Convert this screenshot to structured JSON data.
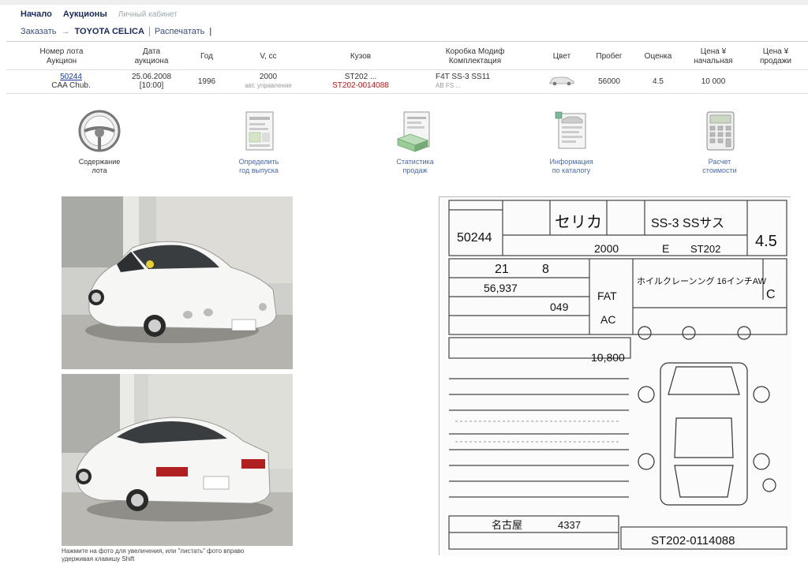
{
  "nav": {
    "home": "Начало",
    "auctions": "Аукционы",
    "cabinet": "Личный кабинет"
  },
  "breadcrumb": {
    "order": "Заказать",
    "arrow": "→",
    "model": "TOYOTA CELICA",
    "separator": "|",
    "print": "Распечатать",
    "end": "|"
  },
  "table": {
    "headers": {
      "lot": [
        "Номер лота",
        "Аукцион"
      ],
      "date": [
        "Дата",
        "аукциона"
      ],
      "year": "Год",
      "cc": "V, cc",
      "body": "Кузов",
      "gear": [
        "Коробка Модиф",
        "Комплектация"
      ],
      "color": "Цвет",
      "run": "Пробег",
      "grade": "Оценка",
      "start": [
        "Цена ¥",
        "начальная"
      ],
      "sell": [
        "Цена ¥",
        "продажи"
      ]
    },
    "row": {
      "lot_no": "50244",
      "auction": "CAA Chub.",
      "date": "25.06.2008",
      "time": "[10:00]",
      "year": "1996",
      "cc": "2000",
      "cc_note": "авт. управление",
      "body": "ST202 ...",
      "body_code": "ST202-0014088",
      "gear": "F4T SS-3 SS11",
      "gear2": "AB FS ...",
      "run": "56000",
      "grade": "4.5",
      "start": "10 000",
      "sell": ""
    }
  },
  "tools": [
    {
      "name": "contents",
      "l1": "Содержание",
      "l2": "лота"
    },
    {
      "name": "define-year",
      "l1": "Определить",
      "l2": "год выпуска"
    },
    {
      "name": "statistics",
      "l1": "Статистика",
      "l2": "продаж"
    },
    {
      "name": "catalog-info",
      "l1": "Информация",
      "l2": "по каталогу"
    },
    {
      "name": "cost-calc",
      "l1": "Расчет",
      "l2": "стоимости"
    }
  ],
  "caption": {
    "l1": "Нажмите на фото для увеличения, или \"листать\" фото вправо",
    "l2": "удерживая клавишу Shift"
  },
  "sheet": {
    "lot": "50244",
    "model": "セリカ",
    "grade_code": "SS-3 SSサス",
    "cc": "2000",
    "fuel": "E",
    "chassis": "ST202",
    "score": "4.5",
    "year": "21",
    "month": "8",
    "mileage": "56,937",
    "color_code": "049",
    "trans": "FAT",
    "ac": "AC",
    "equip": "ホイルクレーンング 16インチAW",
    "interior": "C",
    "recycle": "10,800",
    "vin": "ST202-0114088",
    "location": "名古屋",
    "plate": "4337"
  }
}
